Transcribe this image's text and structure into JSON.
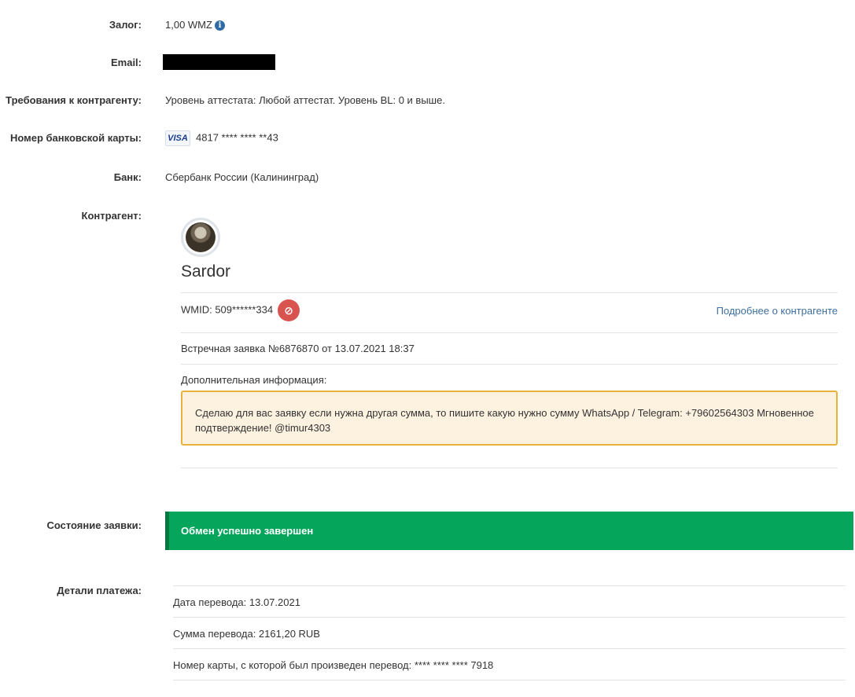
{
  "fields": {
    "deposit_label": "Залог:",
    "deposit_value": "1,00 WMZ",
    "email_label": "Email:",
    "requirements_label": "Требования к контрагенту:",
    "requirements_value": "Уровень аттестата: Любой аттестат. Уровень BL: 0 и выше.",
    "card_label": "Номер банковской карты:",
    "card_brand": "VISA",
    "card_number": "4817 **** **** **43",
    "bank_label": "Банк:",
    "bank_value": "Сбербанк России (Калининград)",
    "counterparty_label": "Контрагент:"
  },
  "counterparty": {
    "name": "Sardor",
    "wmid": "WMID: 509******334",
    "ban_icon": "ban-icon",
    "more_link": "Подробнее о контрагенте",
    "counter_request": "Встречная заявка №6876870 от 13.07.2021 18:37",
    "extra_info_label": "Дополнительная информация:",
    "extra_info_text": "Сделаю для вас заявку если нужна другая сумма, то пишите какую нужно сумму WhatsApp / Telegram: +79602564303 Мгновенное подтверждение! @timur4303"
  },
  "status": {
    "label": "Состояние заявки:",
    "value": "Обмен успешно завершен",
    "color": "#05a65b"
  },
  "payment": {
    "label": "Детали платежа:",
    "rows": [
      "Дата перевода: 13.07.2021",
      "Сумма перевода: 2161,20 RUB",
      "Номер карты, с которой был произведен перевод: **** **** **** 7918"
    ]
  }
}
